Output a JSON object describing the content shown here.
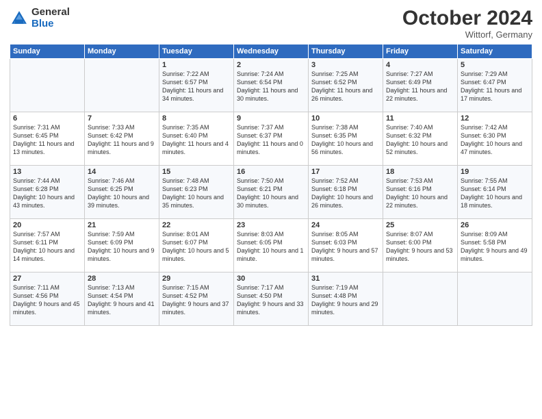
{
  "logo": {
    "general": "General",
    "blue": "Blue"
  },
  "header": {
    "month": "October 2024",
    "location": "Wittorf, Germany"
  },
  "weekdays": [
    "Sunday",
    "Monday",
    "Tuesday",
    "Wednesday",
    "Thursday",
    "Friday",
    "Saturday"
  ],
  "weeks": [
    [
      {
        "day": "",
        "info": ""
      },
      {
        "day": "",
        "info": ""
      },
      {
        "day": "1",
        "info": "Sunrise: 7:22 AM\nSunset: 6:57 PM\nDaylight: 11 hours\nand 34 minutes."
      },
      {
        "day": "2",
        "info": "Sunrise: 7:24 AM\nSunset: 6:54 PM\nDaylight: 11 hours\nand 30 minutes."
      },
      {
        "day": "3",
        "info": "Sunrise: 7:25 AM\nSunset: 6:52 PM\nDaylight: 11 hours\nand 26 minutes."
      },
      {
        "day": "4",
        "info": "Sunrise: 7:27 AM\nSunset: 6:49 PM\nDaylight: 11 hours\nand 22 minutes."
      },
      {
        "day": "5",
        "info": "Sunrise: 7:29 AM\nSunset: 6:47 PM\nDaylight: 11 hours\nand 17 minutes."
      }
    ],
    [
      {
        "day": "6",
        "info": "Sunrise: 7:31 AM\nSunset: 6:45 PM\nDaylight: 11 hours\nand 13 minutes."
      },
      {
        "day": "7",
        "info": "Sunrise: 7:33 AM\nSunset: 6:42 PM\nDaylight: 11 hours\nand 9 minutes."
      },
      {
        "day": "8",
        "info": "Sunrise: 7:35 AM\nSunset: 6:40 PM\nDaylight: 11 hours\nand 4 minutes."
      },
      {
        "day": "9",
        "info": "Sunrise: 7:37 AM\nSunset: 6:37 PM\nDaylight: 11 hours\nand 0 minutes."
      },
      {
        "day": "10",
        "info": "Sunrise: 7:38 AM\nSunset: 6:35 PM\nDaylight: 10 hours\nand 56 minutes."
      },
      {
        "day": "11",
        "info": "Sunrise: 7:40 AM\nSunset: 6:32 PM\nDaylight: 10 hours\nand 52 minutes."
      },
      {
        "day": "12",
        "info": "Sunrise: 7:42 AM\nSunset: 6:30 PM\nDaylight: 10 hours\nand 47 minutes."
      }
    ],
    [
      {
        "day": "13",
        "info": "Sunrise: 7:44 AM\nSunset: 6:28 PM\nDaylight: 10 hours\nand 43 minutes."
      },
      {
        "day": "14",
        "info": "Sunrise: 7:46 AM\nSunset: 6:25 PM\nDaylight: 10 hours\nand 39 minutes."
      },
      {
        "day": "15",
        "info": "Sunrise: 7:48 AM\nSunset: 6:23 PM\nDaylight: 10 hours\nand 35 minutes."
      },
      {
        "day": "16",
        "info": "Sunrise: 7:50 AM\nSunset: 6:21 PM\nDaylight: 10 hours\nand 30 minutes."
      },
      {
        "day": "17",
        "info": "Sunrise: 7:52 AM\nSunset: 6:18 PM\nDaylight: 10 hours\nand 26 minutes."
      },
      {
        "day": "18",
        "info": "Sunrise: 7:53 AM\nSunset: 6:16 PM\nDaylight: 10 hours\nand 22 minutes."
      },
      {
        "day": "19",
        "info": "Sunrise: 7:55 AM\nSunset: 6:14 PM\nDaylight: 10 hours\nand 18 minutes."
      }
    ],
    [
      {
        "day": "20",
        "info": "Sunrise: 7:57 AM\nSunset: 6:11 PM\nDaylight: 10 hours\nand 14 minutes."
      },
      {
        "day": "21",
        "info": "Sunrise: 7:59 AM\nSunset: 6:09 PM\nDaylight: 10 hours\nand 9 minutes."
      },
      {
        "day": "22",
        "info": "Sunrise: 8:01 AM\nSunset: 6:07 PM\nDaylight: 10 hours\nand 5 minutes."
      },
      {
        "day": "23",
        "info": "Sunrise: 8:03 AM\nSunset: 6:05 PM\nDaylight: 10 hours\nand 1 minute."
      },
      {
        "day": "24",
        "info": "Sunrise: 8:05 AM\nSunset: 6:03 PM\nDaylight: 9 hours\nand 57 minutes."
      },
      {
        "day": "25",
        "info": "Sunrise: 8:07 AM\nSunset: 6:00 PM\nDaylight: 9 hours\nand 53 minutes."
      },
      {
        "day": "26",
        "info": "Sunrise: 8:09 AM\nSunset: 5:58 PM\nDaylight: 9 hours\nand 49 minutes."
      }
    ],
    [
      {
        "day": "27",
        "info": "Sunrise: 7:11 AM\nSunset: 4:56 PM\nDaylight: 9 hours\nand 45 minutes."
      },
      {
        "day": "28",
        "info": "Sunrise: 7:13 AM\nSunset: 4:54 PM\nDaylight: 9 hours\nand 41 minutes."
      },
      {
        "day": "29",
        "info": "Sunrise: 7:15 AM\nSunset: 4:52 PM\nDaylight: 9 hours\nand 37 minutes."
      },
      {
        "day": "30",
        "info": "Sunrise: 7:17 AM\nSunset: 4:50 PM\nDaylight: 9 hours\nand 33 minutes."
      },
      {
        "day": "31",
        "info": "Sunrise: 7:19 AM\nSunset: 4:48 PM\nDaylight: 9 hours\nand 29 minutes."
      },
      {
        "day": "",
        "info": ""
      },
      {
        "day": "",
        "info": ""
      }
    ]
  ]
}
